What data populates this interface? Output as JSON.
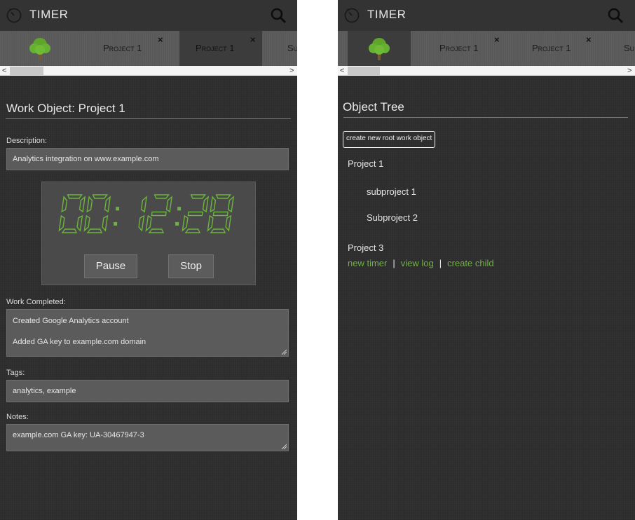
{
  "left_screen": {
    "header": {
      "title": "TIMER",
      "app_icon": "stopwatch-icon",
      "search_icon": "search-icon"
    },
    "tabs": [
      {
        "type": "tree",
        "icon": "tree-icon"
      },
      {
        "label": "Project 1",
        "close": "×"
      },
      {
        "label": "Project 1",
        "close": "×",
        "active": true
      },
      {
        "label": "Su"
      }
    ],
    "scrollbar": {
      "left_arrow": "<",
      "right_arrow": ">"
    },
    "page_title": "Work Object: Project 1",
    "description": {
      "label": "Description:",
      "value": "Analytics integration on www.example.com"
    },
    "timer": {
      "display": "00:12:28",
      "pause_label": "Pause",
      "stop_label": "Stop"
    },
    "work_completed": {
      "label": "Work Completed:",
      "lines": [
        "Created Google Analytics account",
        "Added GA key to example.com domain"
      ]
    },
    "tags": {
      "label": "Tags:",
      "value": "analytics, example"
    },
    "notes": {
      "label": "Notes:",
      "value": "example.com GA key: UA-30467947-3"
    }
  },
  "right_screen": {
    "header": {
      "title": "TIMER",
      "app_icon": "stopwatch-icon",
      "search_icon": "search-icon"
    },
    "tabs": [
      {
        "type": "tree",
        "icon": "tree-icon",
        "active": true
      },
      {
        "label": "Project 1",
        "close": "×"
      },
      {
        "label": "Project 1",
        "close": "×"
      },
      {
        "label": "Su"
      }
    ],
    "scrollbar": {
      "left_arrow": "<",
      "right_arrow": ">"
    },
    "section_title": "Object Tree",
    "create_root_label": "create new root work object",
    "tree": [
      {
        "label": "Project 1"
      },
      {
        "label": "subproject 1"
      },
      {
        "label": "Subproject 2"
      },
      {
        "label": "Project 3"
      }
    ],
    "actions": {
      "new_timer": "new timer",
      "separator": "|",
      "view_log": "view log",
      "create_child": "create child"
    }
  },
  "colors": {
    "accent": "#6db33f",
    "panel_bg": "#2d2d2d",
    "tab_bar": "#595959",
    "field_bg": "#5b5b5b"
  }
}
